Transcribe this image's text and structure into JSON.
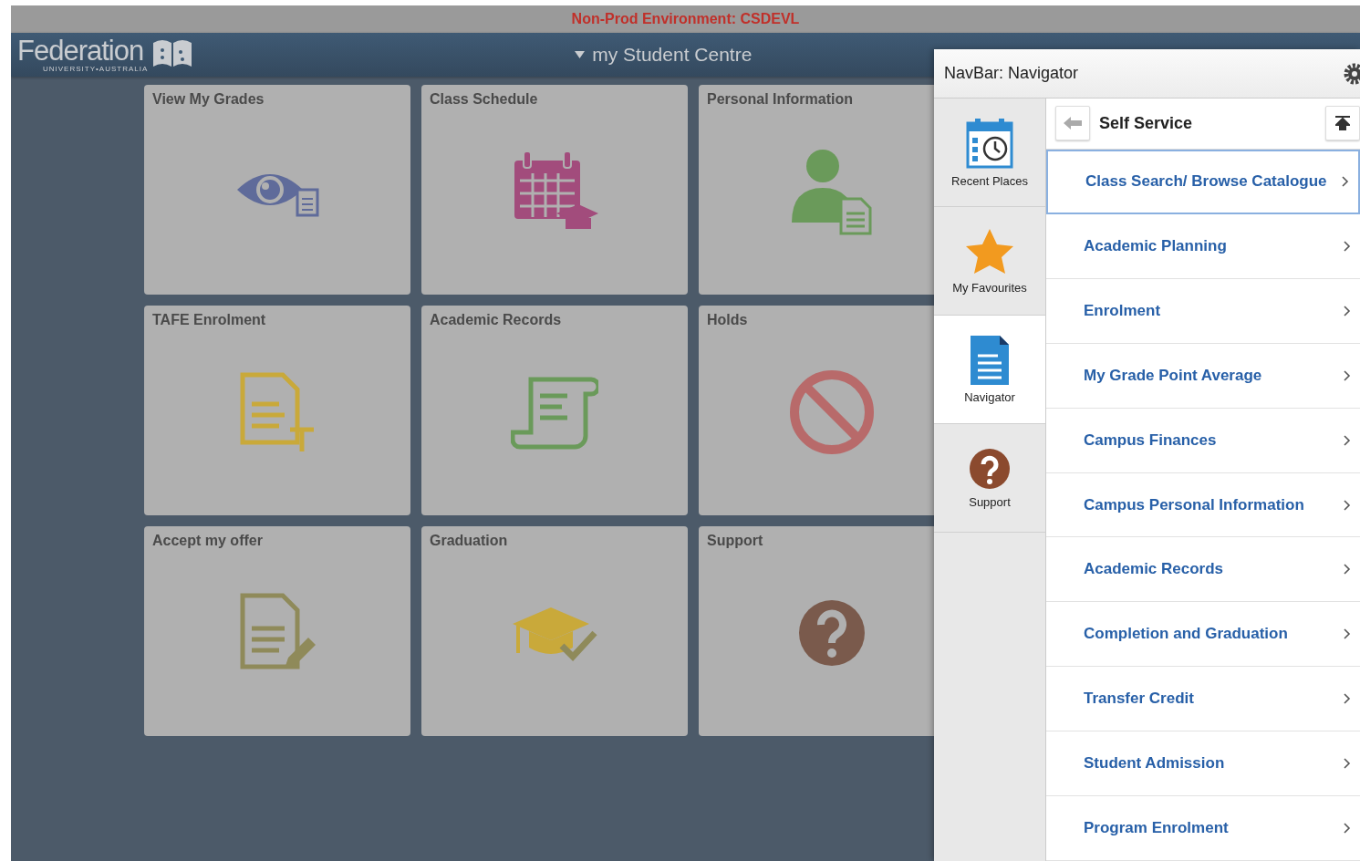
{
  "environment_banner": "Non-Prod Environment: CSDEVL",
  "logo": {
    "name": "Federation",
    "tagline": "UNIVERSITY•AUSTRALIA"
  },
  "header": {
    "title": "my Student Centre"
  },
  "tiles": [
    {
      "title": "View My Grades",
      "kind": "grades"
    },
    {
      "title": "Class Schedule",
      "kind": "schedule"
    },
    {
      "title": "Personal Information",
      "kind": "personal"
    },
    {
      "title": "TAFE Enrolment",
      "kind": "tafe"
    },
    {
      "title": "Academic Records",
      "kind": "records"
    },
    {
      "title": "Holds",
      "kind": "holds"
    },
    {
      "title": "Accept my offer",
      "kind": "offer"
    },
    {
      "title": "Graduation",
      "kind": "graduation"
    },
    {
      "title": "Support",
      "kind": "support"
    }
  ],
  "navbar": {
    "title": "NavBar: Navigator",
    "tabs": [
      {
        "label": "Recent Places",
        "kind": "recent",
        "selected": false
      },
      {
        "label": "My Favourites",
        "kind": "favourites",
        "selected": false
      },
      {
        "label": "Navigator",
        "kind": "navigator",
        "selected": true
      },
      {
        "label": "Support",
        "kind": "support",
        "selected": false
      }
    ],
    "folder": "Self Service",
    "items": [
      {
        "label": "Class Search/ Browse Catalogue",
        "selected": true
      },
      {
        "label": "Academic Planning",
        "selected": false
      },
      {
        "label": "Enrolment",
        "selected": false
      },
      {
        "label": "My Grade Point Average",
        "selected": false
      },
      {
        "label": "Campus Finances",
        "selected": false
      },
      {
        "label": "Campus Personal Information",
        "selected": false
      },
      {
        "label": "Academic Records",
        "selected": false
      },
      {
        "label": "Completion and Graduation",
        "selected": false
      },
      {
        "label": "Transfer Credit",
        "selected": false
      },
      {
        "label": "Student Admission",
        "selected": false
      },
      {
        "label": "Program Enrolment",
        "selected": false
      }
    ]
  }
}
